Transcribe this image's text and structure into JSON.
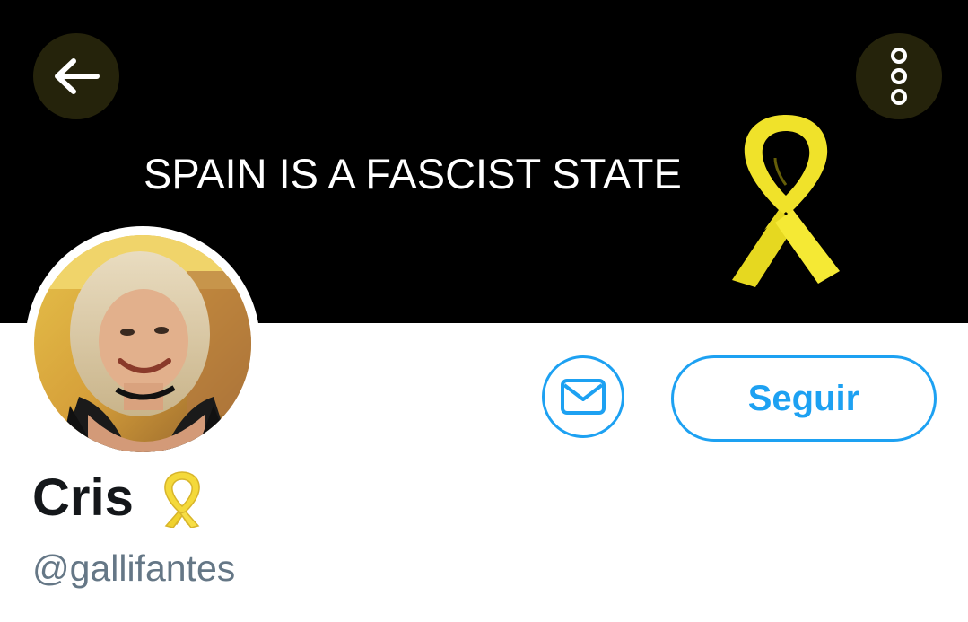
{
  "header": {
    "banner_text": "SPAIN IS A FASCIST STATE",
    "back_icon": "arrow-left-icon",
    "more_icon": "vertical-ellipsis-icon",
    "button_background": "#25230b",
    "banner_background": "#000000",
    "ribbon_color": "#f5e61f"
  },
  "profile": {
    "display_name": "Cris",
    "name_emoji": "yellow-ribbon-icon",
    "handle": "@gallifantes",
    "avatar": "profile-photo"
  },
  "actions": {
    "message_icon": "envelope-icon",
    "follow_label": "Seguir",
    "accent_color": "#1da1f2"
  }
}
